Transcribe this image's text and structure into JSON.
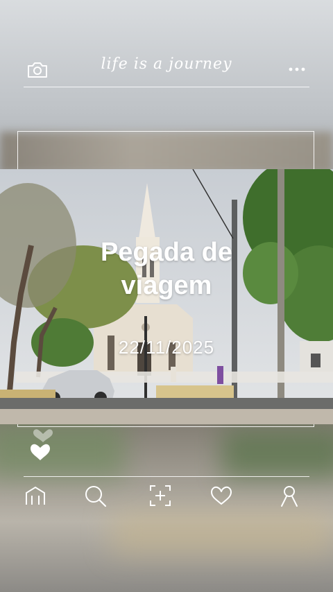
{
  "header": {
    "title": "life is a journey",
    "camera_icon": "camera-icon",
    "menu_icon": "more-dots-icon"
  },
  "post": {
    "caption_line1": "Pegada de",
    "caption_line2": "viagem",
    "date": "22/11/2025",
    "like_icon": "heart-icon"
  },
  "nav": {
    "items": [
      {
        "icon": "home-icon"
      },
      {
        "icon": "search-icon"
      },
      {
        "icon": "add-icon"
      },
      {
        "icon": "heart-icon"
      },
      {
        "icon": "profile-icon"
      }
    ]
  },
  "colors": {
    "line": "#ffffff",
    "text": "#ffffff"
  }
}
